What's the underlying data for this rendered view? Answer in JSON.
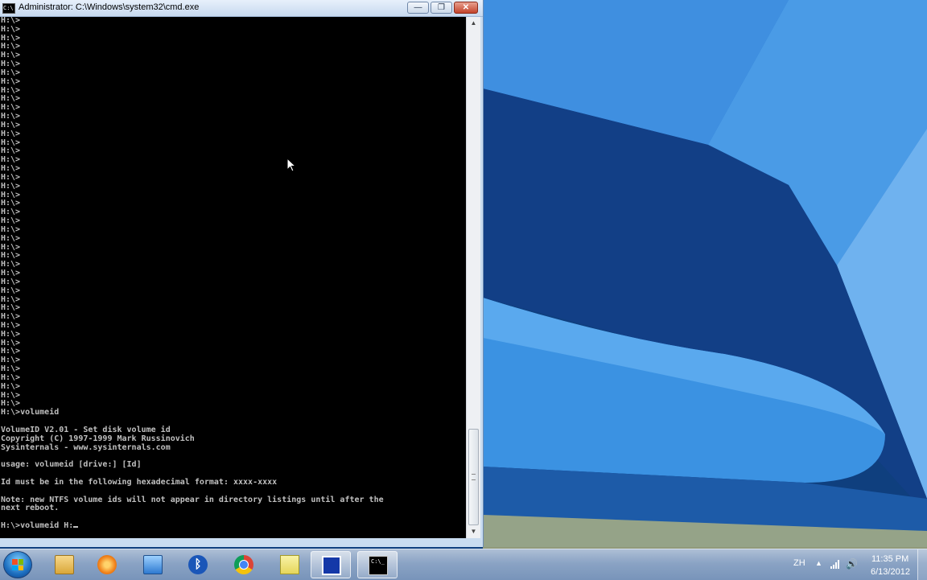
{
  "window": {
    "title": "Administrator: C:\\Windows\\system32\\cmd.exe",
    "icon_label": "C:\\",
    "buttons": {
      "minimize": "—",
      "restore": "❐",
      "close": "✕"
    }
  },
  "console": {
    "prompt": "H:\\>",
    "prompt_repeat_count": 45,
    "lines": [
      "H:\\>volumeid",
      "",
      "VolumeID V2.01 - Set disk volume id",
      "Copyright (C) 1997-1999 Mark Russinovich",
      "Sysinternals - www.sysinternals.com",
      "",
      "usage: volumeid [drive:] [Id]",
      "",
      "Id must be in the following hexadecimal format: xxxx-xxxx",
      "",
      "Note: new NTFS volume ids will not appear in directory listings until after the",
      "next reboot.",
      "",
      "H:\\>volumeid H:"
    ]
  },
  "taskbar": {
    "items": [
      {
        "name": "tb-explorer",
        "icon": "folder-icon",
        "active": false
      },
      {
        "name": "tb-media",
        "icon": "media-player-icon",
        "active": false
      },
      {
        "name": "tb-network",
        "icon": "network-computer-icon",
        "active": false
      },
      {
        "name": "tb-bluetooth",
        "icon": "bluetooth-icon",
        "active": false,
        "glyph": "ᛒ"
      },
      {
        "name": "tb-chrome",
        "icon": "chrome-icon",
        "active": false
      },
      {
        "name": "tb-notes",
        "icon": "sticky-notes-icon",
        "active": false
      },
      {
        "name": "tb-remote",
        "icon": "remote-app-icon",
        "active": true
      },
      {
        "name": "tb-cmd",
        "icon": "cmd-icon",
        "active": true,
        "glyph": "C:\\_"
      }
    ],
    "tray": {
      "language": "ZH",
      "arrow": "▲",
      "volume": "🔊",
      "time": "11:35 PM",
      "date": "6/13/2012"
    }
  },
  "colors": {
    "console_bg": "#000000",
    "console_fg": "#c0c0c0",
    "accent": "#1d6fc0"
  }
}
